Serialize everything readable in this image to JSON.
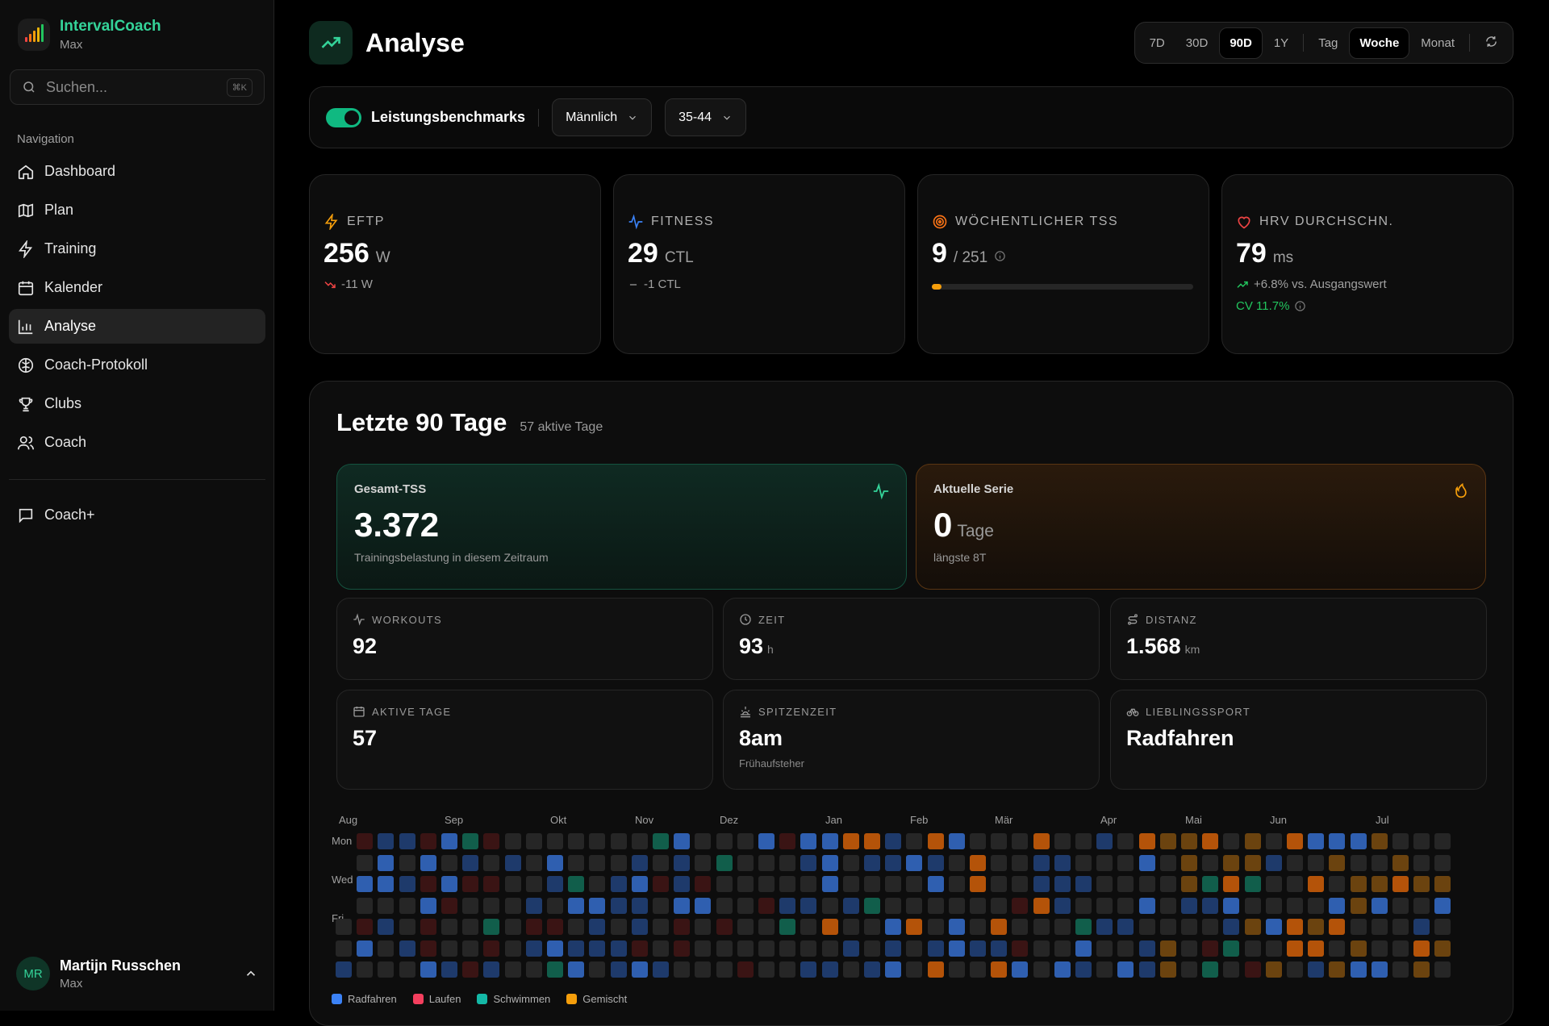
{
  "app": {
    "name": "IntervalCoach",
    "subtitle": "Max"
  },
  "search": {
    "placeholder": "Suchen...",
    "shortcut": "⌘K"
  },
  "nav": {
    "heading": "Navigation",
    "items": [
      {
        "label": "Dashboard",
        "icon": "home-icon"
      },
      {
        "label": "Plan",
        "icon": "map-icon"
      },
      {
        "label": "Training",
        "icon": "bolt-icon"
      },
      {
        "label": "Kalender",
        "icon": "calendar-icon"
      },
      {
        "label": "Analyse",
        "icon": "bar-chart-icon",
        "active": true
      },
      {
        "label": "Coach-Protokoll",
        "icon": "brain-icon"
      },
      {
        "label": "Clubs",
        "icon": "trophy-icon"
      },
      {
        "label": "Coach",
        "icon": "users-icon"
      }
    ],
    "extra": {
      "label": "Coach+",
      "icon": "chat-icon"
    }
  },
  "user": {
    "initials": "MR",
    "name": "Martijn Russchen",
    "subtitle": "Max"
  },
  "header": {
    "title": "Analyse"
  },
  "range": {
    "periods": [
      "7D",
      "30D",
      "90D",
      "1Y"
    ],
    "active_period": "90D",
    "granularity": [
      "Tag",
      "Woche",
      "Monat"
    ],
    "active_granularity": "Woche"
  },
  "benchmarks": {
    "label": "Leistungsbenchmarks",
    "enabled": true,
    "gender": "Männlich",
    "age": "35-44"
  },
  "kpis": {
    "eftp": {
      "label": "EFTP",
      "value": "256",
      "unit": "W",
      "delta": "-11 W"
    },
    "fitness": {
      "label": "FITNESS",
      "value": "29",
      "unit": "CTL",
      "delta": "-1 CTL"
    },
    "tss": {
      "label": "WÖCHENTLICHER TSS",
      "value": "9",
      "target": "/ 251",
      "progress": 0.036
    },
    "hrv": {
      "label": "HRV DURCHSCHN.",
      "value": "79",
      "unit": "ms",
      "delta": "+6.8% vs. Ausgangswert",
      "cv": "CV 11.7%"
    }
  },
  "summary": {
    "title": "Letzte 90 Tage",
    "subtitle": "57 aktive Tage",
    "total_tss": {
      "label": "Gesamt-TSS",
      "value": "3.372",
      "caption": "Trainingsbelastung in diesem Zeitraum"
    },
    "streak": {
      "label": "Aktuelle Serie",
      "value": "0",
      "unit": "Tage",
      "caption": "längste 8T"
    },
    "stats": [
      {
        "label": "WORKOUTS",
        "value": "92",
        "unit": "",
        "caption": "",
        "icon": "activity-icon"
      },
      {
        "label": "ZEIT",
        "value": "93",
        "unit": "h",
        "caption": "",
        "icon": "clock-icon"
      },
      {
        "label": "DISTANZ",
        "value": "1.568",
        "unit": "km",
        "caption": "",
        "icon": "route-icon"
      },
      {
        "label": "AKTIVE TAGE",
        "value": "57",
        "unit": "",
        "caption": "",
        "icon": "calendar-icon"
      },
      {
        "label": "SPITZENZEIT",
        "value": "8am",
        "unit": "",
        "caption": "Frühaufsteher",
        "icon": "sunrise-icon"
      },
      {
        "label": "LIEBLINGSSPORT",
        "value": "Radfahren",
        "unit": "",
        "caption": "",
        "icon": "bike-icon"
      }
    ]
  },
  "heatmap": {
    "months": [
      "Aug",
      "Sep",
      "Okt",
      "Nov",
      "Dez",
      "Jan",
      "Feb",
      "Mär",
      "Apr",
      "Mai",
      "Jun",
      "Jul"
    ],
    "day_labels": [
      "Mon",
      "Wed",
      "Fri"
    ],
    "legend": [
      {
        "label": "Radfahren",
        "color": "#3b82f6"
      },
      {
        "label": "Laufen",
        "color": "#f43f5e"
      },
      {
        "label": "Schwimmen",
        "color": "#14b8a6"
      },
      {
        "label": "Gemischt",
        "color": "#f59e0b"
      }
    ]
  },
  "colors": {
    "accent": "#34d399",
    "cycling": "#2f5fb0",
    "running": "#7f1d1d",
    "swimming": "#115e4b",
    "mixed": "#b45309",
    "empty": "#262626"
  }
}
